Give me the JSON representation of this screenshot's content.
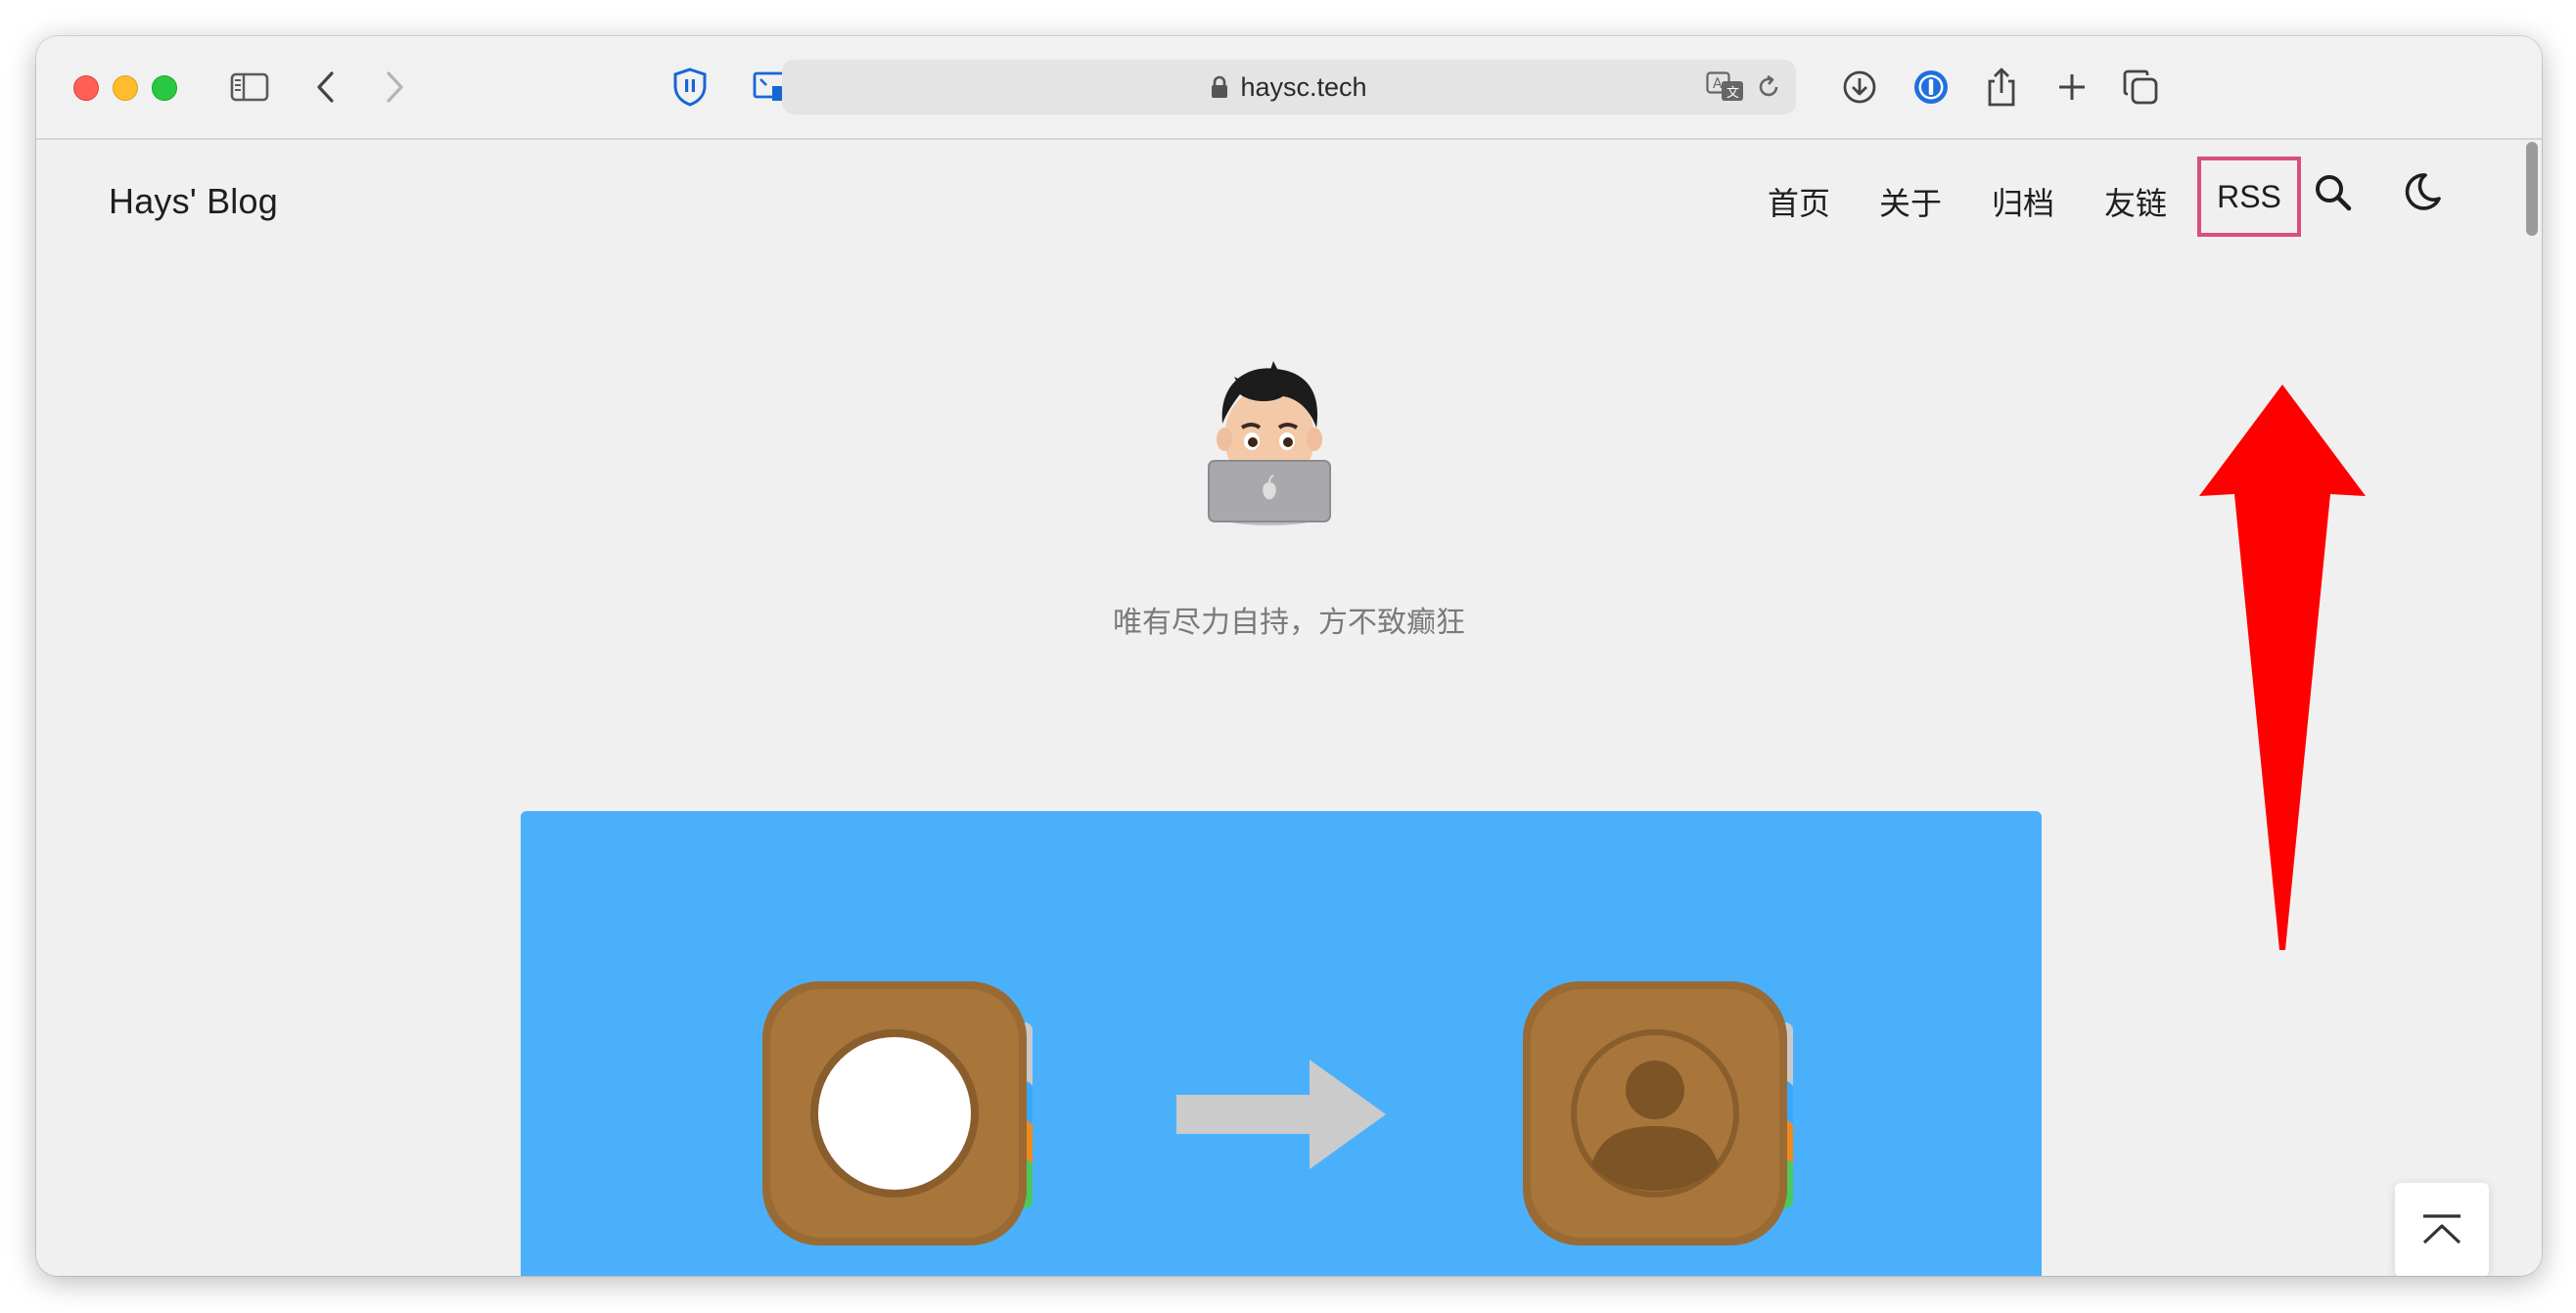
{
  "browser": {
    "address": {
      "url": "haysc.tech",
      "lock_icon": "lock-icon",
      "translate_icon": "translate-icon",
      "reload_icon": "reload-icon"
    },
    "toolbar_icons": [
      "sidebar-icon",
      "back-icon",
      "forward-icon",
      "bitwarden-shield-icon",
      "picture-in-picture-icon",
      "download-icon",
      "1password-icon",
      "share-icon",
      "new-tab-icon",
      "tabs-overview-icon"
    ]
  },
  "site": {
    "brand": "Hays' Blog",
    "nav": {
      "home": "首页",
      "about": "关于",
      "archive": "归档",
      "links": "友链",
      "rss": "RSS"
    },
    "search_icon": "search-icon",
    "theme_icon": "moon-icon",
    "motto": "唯有尽力自持，方不致癫狂",
    "hero": {
      "background": "#4bb0fb",
      "left_icon": "contacts-app-blank-icon",
      "right_icon": "contacts-app-person-icon"
    },
    "back_to_top_icon": "back-to-top-icon"
  },
  "annotation": {
    "highlight_color": "#d94e7c",
    "arrow_color": "#ff0000"
  }
}
